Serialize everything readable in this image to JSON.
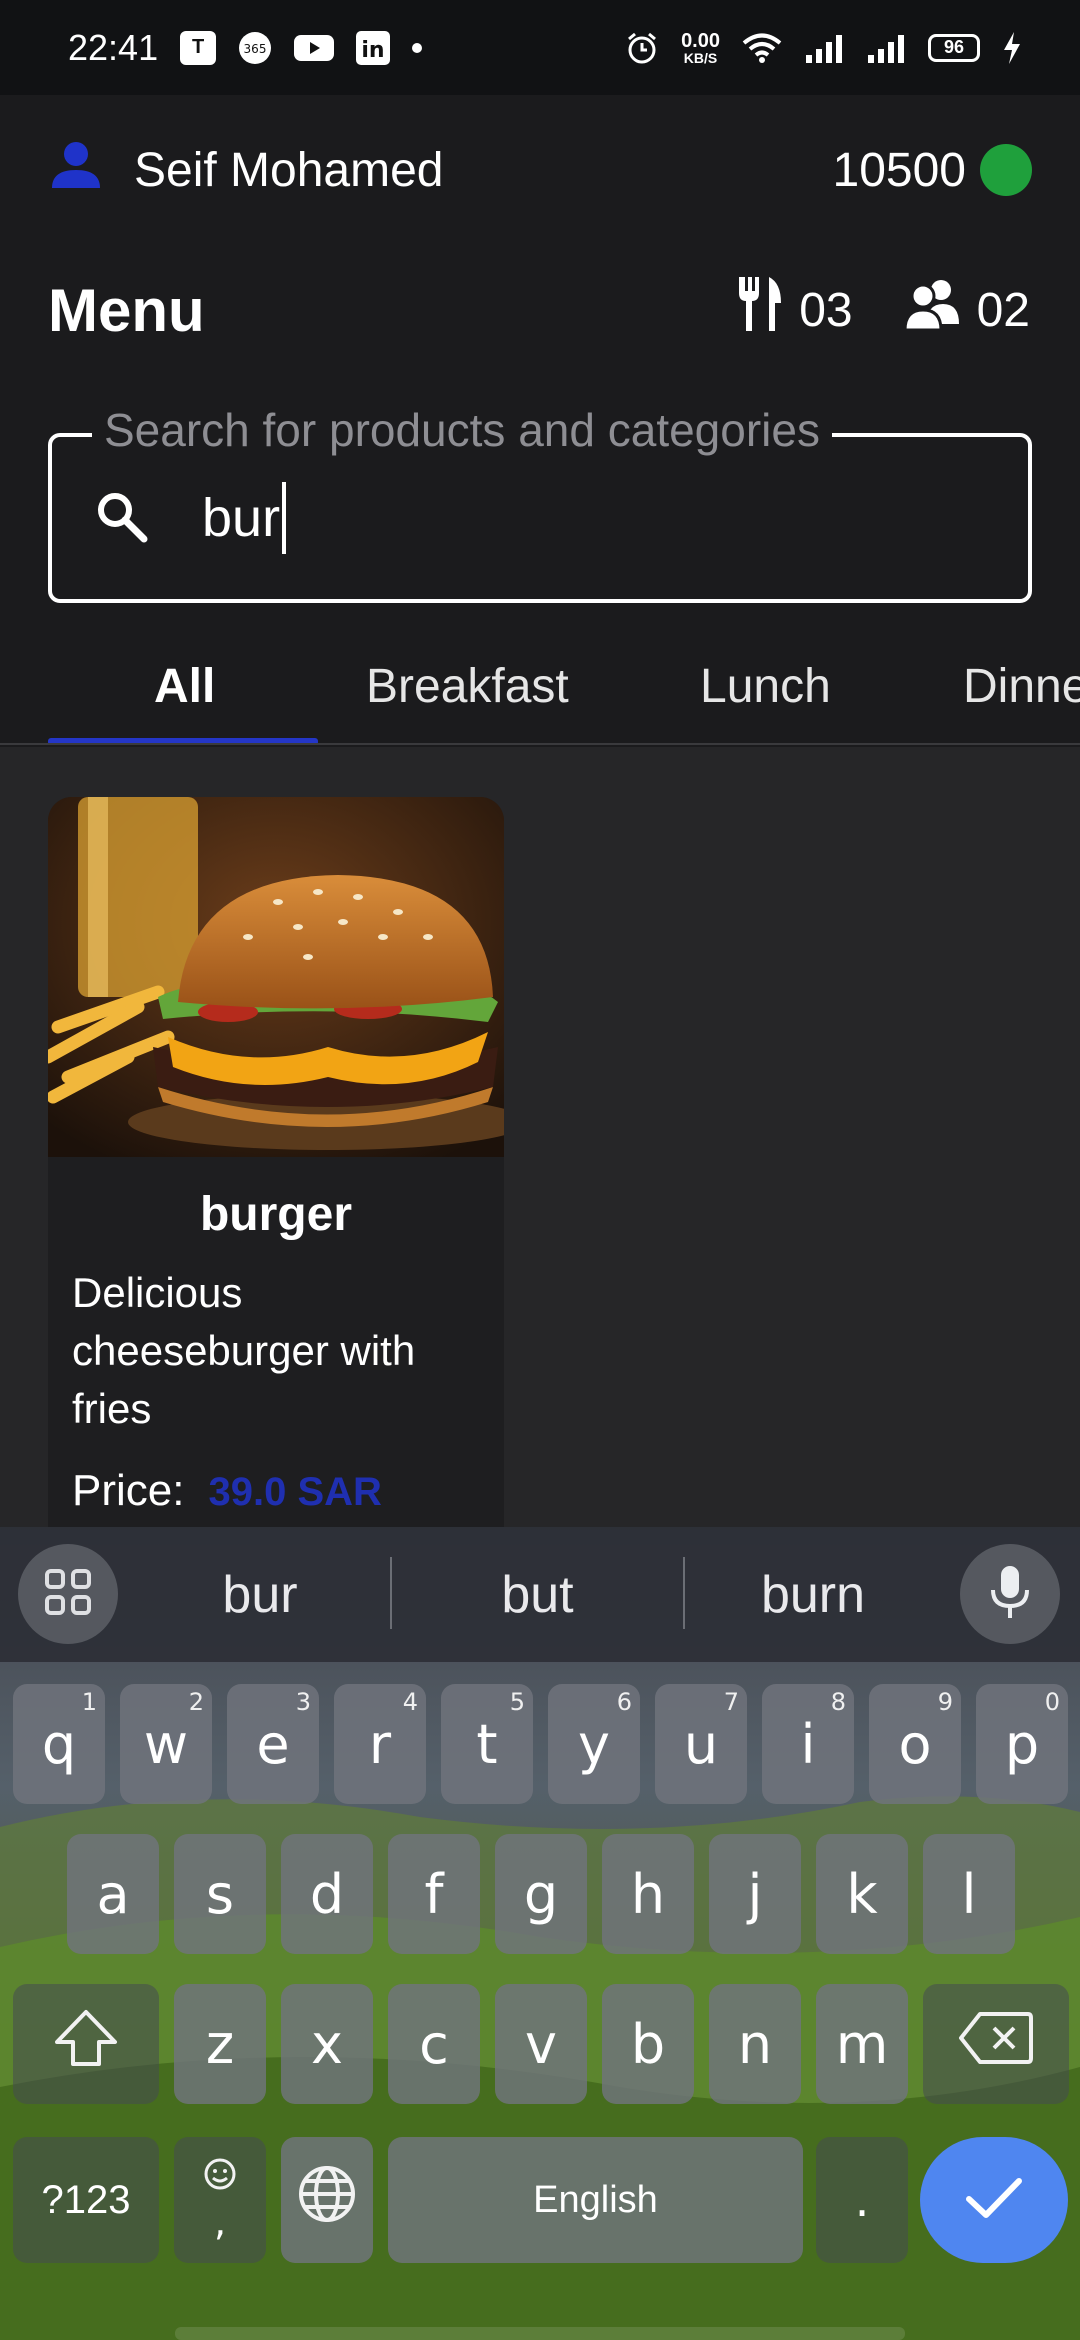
{
  "status_bar": {
    "time": "22:41",
    "app_icons": [
      "teams-icon",
      "office365-icon",
      "youtube-icon",
      "linkedin-icon"
    ],
    "net_speed_value": "0.00",
    "net_speed_unit": "KB/S",
    "battery": "96"
  },
  "header": {
    "user_name": "Seif Mohamed",
    "points": "10500",
    "status_color": "#1fa03c"
  },
  "menu": {
    "title": "Menu",
    "utensils_count": "03",
    "guests_count": "02"
  },
  "search": {
    "label": "Search for products and categories",
    "value": "bur"
  },
  "tabs": [
    {
      "label": "All",
      "active": true
    },
    {
      "label": "Breakfast",
      "active": false
    },
    {
      "label": "Lunch",
      "active": false
    },
    {
      "label": "Dinner",
      "active": false
    }
  ],
  "products": [
    {
      "name": "burger",
      "description": "Delicious cheeseburger with fries",
      "price_label": "Price:",
      "price": "39.0 SAR"
    }
  ],
  "keyboard": {
    "suggestions": [
      "bur",
      "but",
      "burn"
    ],
    "row1": [
      {
        "key": "q",
        "num": "1"
      },
      {
        "key": "w",
        "num": "2"
      },
      {
        "key": "e",
        "num": "3"
      },
      {
        "key": "r",
        "num": "4"
      },
      {
        "key": "t",
        "num": "5"
      },
      {
        "key": "y",
        "num": "6"
      },
      {
        "key": "u",
        "num": "7"
      },
      {
        "key": "i",
        "num": "8"
      },
      {
        "key": "o",
        "num": "9"
      },
      {
        "key": "p",
        "num": "0"
      }
    ],
    "row2": [
      "a",
      "s",
      "d",
      "f",
      "g",
      "h",
      "j",
      "k",
      "l"
    ],
    "row3": [
      "z",
      "x",
      "c",
      "v",
      "b",
      "n",
      "m"
    ],
    "symbols_label": "?123",
    "comma": ",",
    "space_label": "English",
    "period": ".",
    "accent_color": "#4f86f0"
  }
}
